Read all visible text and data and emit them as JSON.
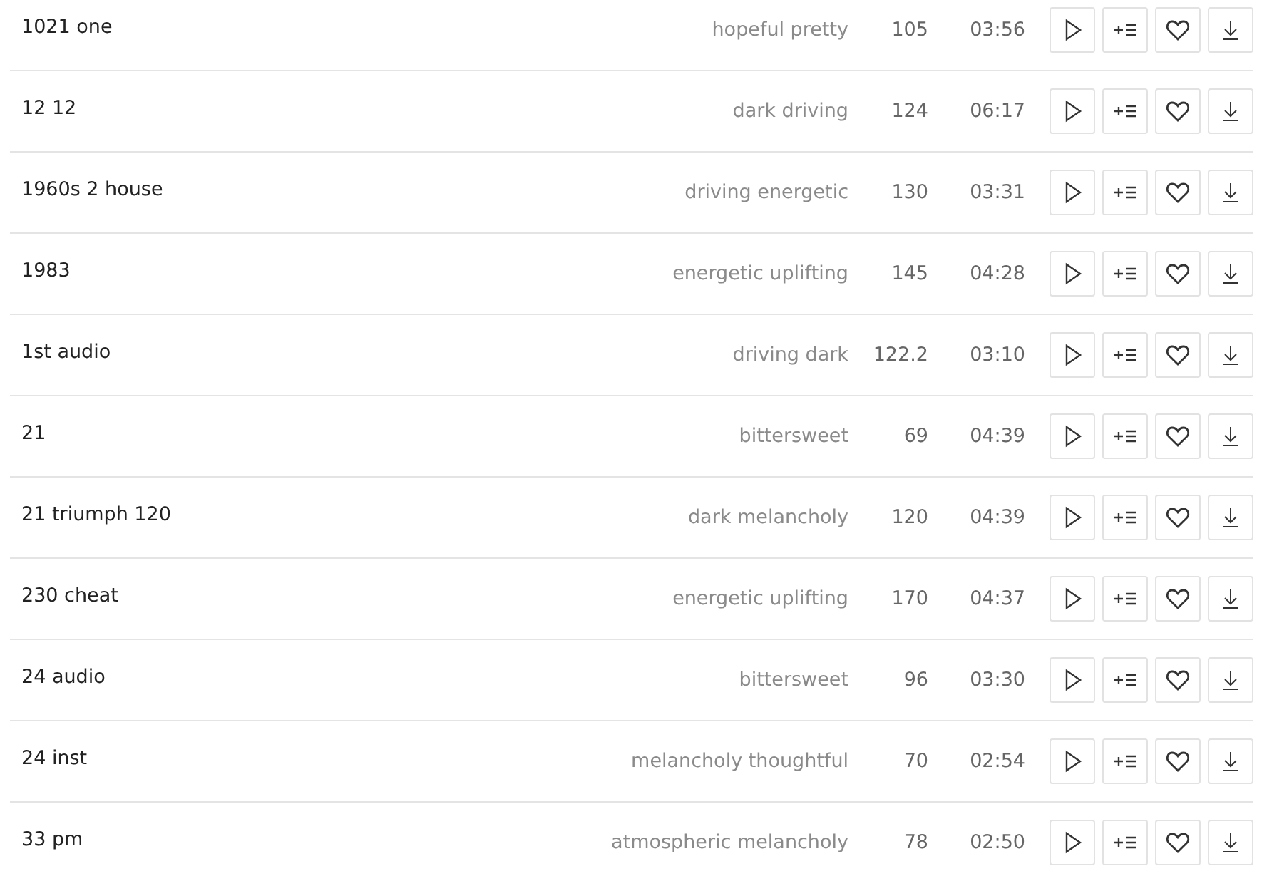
{
  "tracks": [
    {
      "title": "1021 one",
      "tags": "hopeful pretty",
      "bpm": "105",
      "duration": "03:56"
    },
    {
      "title": "12 12",
      "tags": "dark driving",
      "bpm": "124",
      "duration": "06:17"
    },
    {
      "title": "1960s 2 house",
      "tags": "driving energetic",
      "bpm": "130",
      "duration": "03:31"
    },
    {
      "title": "1983",
      "tags": "energetic uplifting",
      "bpm": "145",
      "duration": "04:28"
    },
    {
      "title": "1st audio",
      "tags": "driving dark",
      "bpm": "122.2",
      "duration": "03:10"
    },
    {
      "title": "21",
      "tags": "bittersweet",
      "bpm": "69",
      "duration": "04:39"
    },
    {
      "title": "21 triumph 120",
      "tags": "dark melancholy",
      "bpm": "120",
      "duration": "04:39"
    },
    {
      "title": "230 cheat",
      "tags": "energetic uplifting",
      "bpm": "170",
      "duration": "04:37"
    },
    {
      "title": "24 audio",
      "tags": "bittersweet",
      "bpm": "96",
      "duration": "03:30"
    },
    {
      "title": "24 inst",
      "tags": "melancholy thoughtful",
      "bpm": "70",
      "duration": "02:54"
    },
    {
      "title": "33 pm",
      "tags": "atmospheric melancholy",
      "bpm": "78",
      "duration": "02:50"
    }
  ]
}
